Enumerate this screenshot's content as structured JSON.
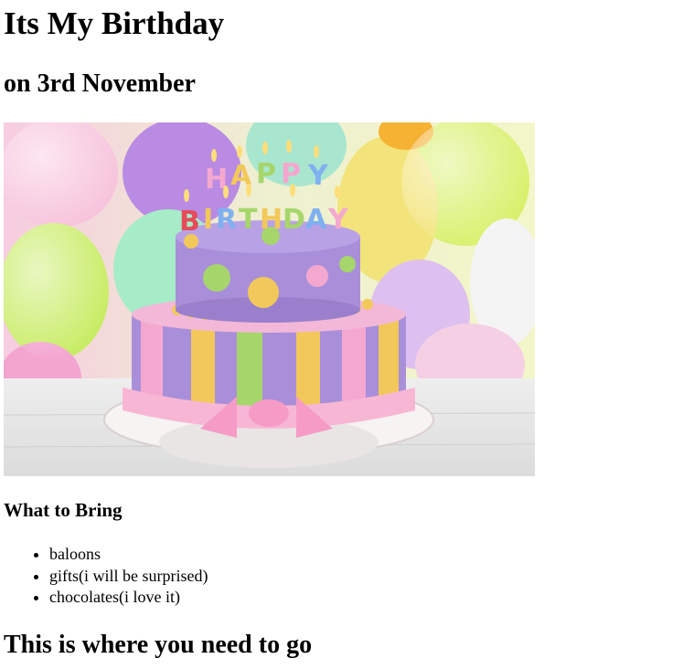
{
  "heading": "Its My Birthday",
  "subheading": "on 3rd November",
  "image": {
    "icon": "birthday-cake-image",
    "cake_text": "HAPPY BIRTHDAY"
  },
  "bring_heading": "What to Bring",
  "bring_items": [
    "baloons",
    "gifts(i will be surprised)",
    "chocolates(i love it)"
  ],
  "directions_heading": "This is where you need to go"
}
